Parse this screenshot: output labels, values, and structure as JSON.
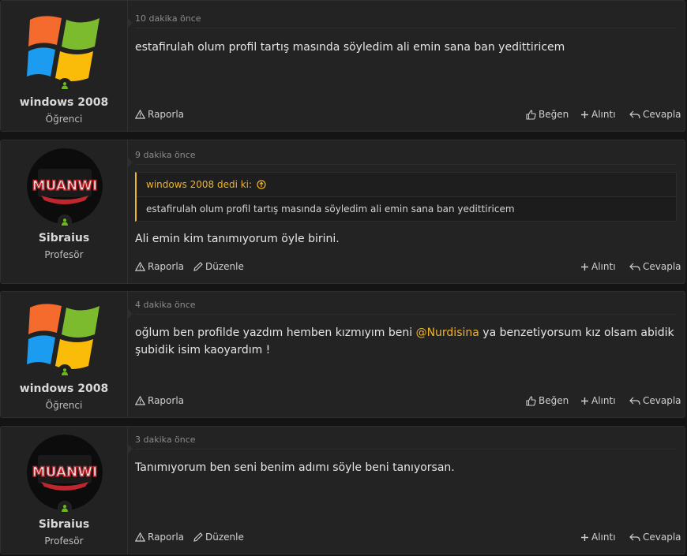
{
  "posts": [
    {
      "author": "windows 2008",
      "role": "Öğrenci",
      "avatar": "windows-logo-avatar",
      "time": "10 dakika önce",
      "body": "estafirulah olum profil tartış masında söyledim ali emin sana ban yedittiricem",
      "actions": {
        "report": "Raporla",
        "like": "Beğen",
        "quote": "Alıntı",
        "reply": "Cevapla"
      }
    },
    {
      "author": "Sibraius",
      "role": "Profesör",
      "avatar": "muanwi-logo-avatar",
      "avatar_text": "MUANWI",
      "time": "9 dakika önce",
      "quote": {
        "head": "windows 2008 dedi ki:",
        "body": "estafirulah olum profil tartış masında söyledim ali emin sana ban yedittiricem"
      },
      "body": "Ali emin kim tanımıyorum öyle birini.",
      "actions": {
        "report": "Raporla",
        "edit": "Düzenle",
        "quote": "Alıntı",
        "reply": "Cevapla"
      }
    },
    {
      "author": "windows 2008",
      "role": "Öğrenci",
      "avatar": "windows-logo-avatar",
      "time": "4 dakika önce",
      "body_pre": "oğlum ben profilde yazdım hemben kızmıyım beni ",
      "mention": "@Nurdisina",
      "body_post": " ya benzetiyorsum kız olsam abidik şubidik isim kaoyardım !",
      "actions": {
        "report": "Raporla",
        "like": "Beğen",
        "quote": "Alıntı",
        "reply": "Cevapla"
      }
    },
    {
      "author": "Sibraius",
      "role": "Profesör",
      "avatar": "muanwi-logo-avatar",
      "avatar_text": "MUANWI",
      "time": "3 dakika önce",
      "body": "Tanımıyorum ben seni benim adımı söyle beni tanıyorsan.",
      "actions": {
        "report": "Raporla",
        "edit": "Düzenle",
        "quote": "Alıntı",
        "reply": "Cevapla"
      }
    }
  ],
  "colors": {
    "accent": "#f0b429",
    "online": "#6ab819",
    "background": "#232323"
  }
}
